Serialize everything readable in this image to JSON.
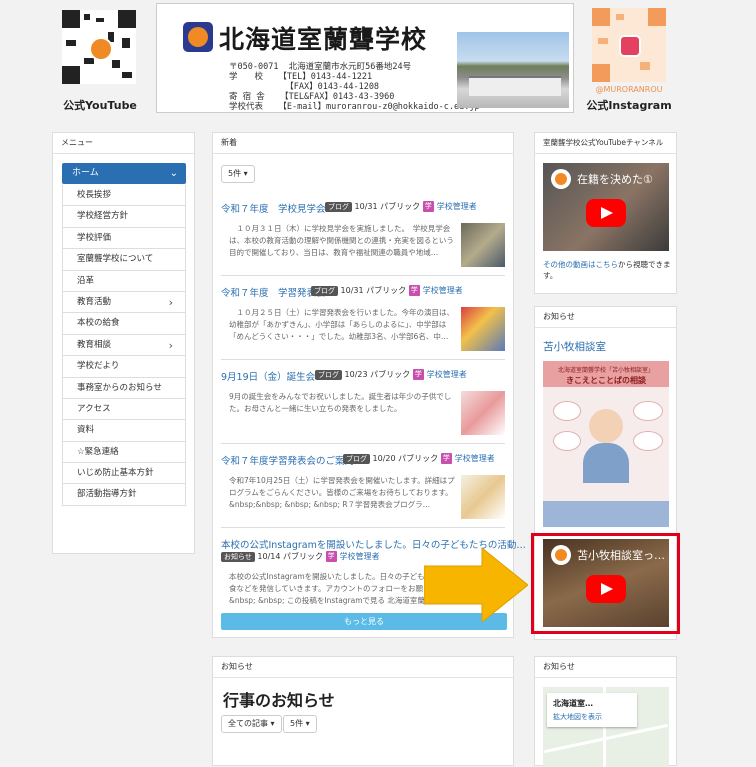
{
  "header": {
    "youtube_label": "公式YouTube",
    "instagram_label": "公式Instagram",
    "instagram_handle": "@MURORANROU",
    "school_name": "北海道室蘭聾学校",
    "address_block": "〒050-0071  北海道室蘭市水元町56番地24号\n学　　校   【TEL】0143-44-1221\n           【FAX】0143-44-1208\n寄 宿 舎   【TEL&FAX】0143-43-3960\n学校代表   【E-mail】muroranrou-z0@hokkaido-c.ed.jp"
  },
  "menu": {
    "heading": "メニュー",
    "home": "ホーム",
    "items": [
      {
        "label": "校長挨拶",
        "arrow": ""
      },
      {
        "label": "学校経営方針",
        "arrow": ""
      },
      {
        "label": "学校評価",
        "arrow": ""
      },
      {
        "label": "室蘭聾学校について",
        "arrow": ""
      },
      {
        "label": "沿革",
        "arrow": ""
      },
      {
        "label": "教育活動",
        "arrow": "›"
      },
      {
        "label": "本校の給食",
        "arrow": ""
      },
      {
        "label": "教育相談",
        "arrow": "›"
      },
      {
        "label": "学校だより",
        "arrow": ""
      },
      {
        "label": "事務室からのお知らせ",
        "arrow": ""
      },
      {
        "label": "アクセス",
        "arrow": ""
      },
      {
        "label": "資料",
        "arrow": ""
      },
      {
        "label": "☆緊急連絡",
        "arrow": ""
      },
      {
        "label": "いじめ防止基本方針",
        "arrow": ""
      },
      {
        "label": "部活動指導方針",
        "arrow": ""
      }
    ]
  },
  "news": {
    "heading": "新着",
    "count_button": "5件 ▾",
    "more_button": "もっと見る",
    "items": [
      {
        "title": "令和７年度　学校見学会",
        "tag": "ブログ",
        "date": "10/31",
        "visibility": "パブリック",
        "avatar": "学",
        "author": "学校管理者",
        "excerpt": "　１０月３１日（木）に学校見学会を実施しました。　学校見学会は、本校の教育活動の理解や関係機関との連携・充実を図るという目的で開催しており、当日は、教育や福祉関連の職員や地域…"
      },
      {
        "title": "令和７年度　学習発表会",
        "tag": "ブログ",
        "date": "10/31",
        "visibility": "パブリック",
        "avatar": "学",
        "author": "学校管理者",
        "excerpt": "　１０月２５日（土）に学習発表会を行いました。今年の演目は、幼稚部が「あかずきん」、小学部は「あらしのよるに」、中学部は「めんどうくさい・・・」でした。幼稚部3名、小学部6名、中…"
      },
      {
        "title": "9月19日（金）誕生会",
        "tag": "ブログ",
        "date": "10/23",
        "visibility": "パブリック",
        "avatar": "学",
        "author": "学校管理者",
        "excerpt": "9月の誕生会をみんなでお祝いしました。誕生者は年少の子供でした。お母さんと一緒に生い立ちの発表をしました。"
      },
      {
        "title": "令和７年度学習発表会のご案内",
        "tag": "ブログ",
        "date": "10/20",
        "visibility": "パブリック",
        "avatar": "学",
        "author": "学校管理者",
        "excerpt": "令和7年10月25日（土）に学習発表会を開催いたします。詳細はプログラムをごらんください。皆様のご来場をお待ちしております。 &nbsp;&nbsp; &nbsp; &nbsp; R７学習発表会プログラ…"
      },
      {
        "title": "本校の公式Instagramを開設いたしました。日々の子どもたちの活動…",
        "tag": "お知らせ",
        "date": "10/14",
        "visibility": "パブリック",
        "avatar": "学",
        "author": "学校管理者",
        "excerpt": "本校の公式Instagramを開設いたしました。日々の子どもたちの活動や毎日の給食などを発信していきます。アカウントのフォローをお願いいたします。&nbsp; &nbsp; &nbsp; この投稿をInstagramで見る 北海道室蘭聾…"
      }
    ]
  },
  "notice_bottom": {
    "heading": "お知らせ",
    "title": "行事のお知らせ",
    "all_button": "全ての記事 ▾",
    "count_button": "5件 ▾"
  },
  "youtube_panel": {
    "heading": "室蘭聾学校公式YouTubeチャンネル",
    "video_title": "在籍を決めた①",
    "more_prefix": "その他の動画は",
    "more_link": "こちら",
    "more_suffix": "から視聴できます。"
  },
  "notice_panel": {
    "heading": "お知らせ",
    "link": "苫小牧相談室",
    "flyer_title": "北海道室蘭聾学校「苫小牧相談室」",
    "flyer_subtitle": "きこえとことばの相談",
    "video_title": "苫小牧相談室っ…"
  },
  "map_panel": {
    "heading": "お知らせ",
    "place": "北海道室…",
    "map_link": "拡大地図を表示"
  },
  "colors": {
    "accent": "#2a6fb1",
    "more_button": "#5bbbe6",
    "highlight": "#e0001b",
    "arrow": "#f7b500",
    "avatar": "#c84fae"
  }
}
